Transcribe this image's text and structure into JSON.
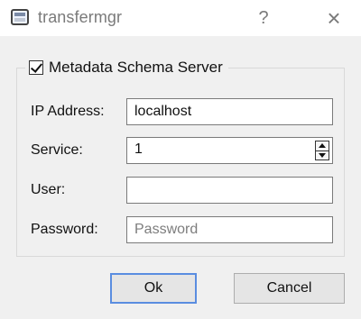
{
  "window": {
    "title": "transfermgr",
    "help_label": "?",
    "close_label": "×"
  },
  "group": {
    "checked": true,
    "title": "Metadata Schema Server"
  },
  "fields": {
    "ip_address": {
      "label": "IP Address:",
      "value": "localhost"
    },
    "service": {
      "label": "Service:",
      "value": "1"
    },
    "user": {
      "label": "User:",
      "value": ""
    },
    "password": {
      "label": "Password:",
      "placeholder": "Password",
      "value": ""
    }
  },
  "buttons": {
    "ok": "Ok",
    "cancel": "Cancel"
  },
  "icons": {
    "app": "app-window-icon",
    "help": "help-icon",
    "close": "close-icon",
    "checkbox": "checkbox-checked-icon",
    "spin_up": "spin-up-icon",
    "spin_down": "spin-down-icon"
  },
  "colors": {
    "background": "#f0f0f0",
    "titlebar": "#ffffff",
    "focus_border": "#5a8de0",
    "button_face": "#e5e5e5"
  }
}
